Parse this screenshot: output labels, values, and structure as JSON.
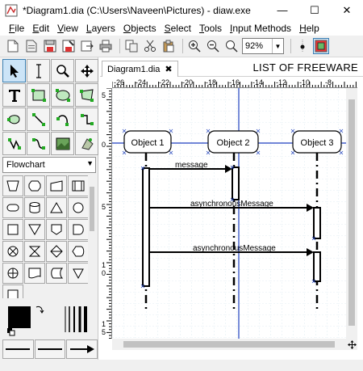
{
  "window": {
    "title": "*Diagram1.dia (C:\\Users\\Naveen\\Pictures) - diaw.exe",
    "minimize": "—",
    "maximize": "☐",
    "close": "✕"
  },
  "menu": [
    {
      "label": "File",
      "u": "F",
      "rest": "ile"
    },
    {
      "label": "Edit",
      "u": "E",
      "rest": "dit"
    },
    {
      "label": "View",
      "u": "V",
      "rest": "iew"
    },
    {
      "label": "Layers",
      "u": "L",
      "rest": "ayers"
    },
    {
      "label": "Objects",
      "u": "O",
      "rest": "bjects"
    },
    {
      "label": "Select",
      "u": "S",
      "rest": "elect"
    },
    {
      "label": "Tools",
      "u": "T",
      "rest": "ools"
    },
    {
      "label": "Input Methods",
      "u": "I",
      "rest": "nput Methods"
    },
    {
      "label": "Help",
      "u": "H",
      "rest": "elp"
    }
  ],
  "toolbar": {
    "zoom": "92%"
  },
  "sheet": {
    "selected": "Flowchart"
  },
  "tab": {
    "label": "Diagram1.dia",
    "close": "✖"
  },
  "diagram": {
    "overlay_title": "LIST OF FREEWARE",
    "objects": [
      "Object 1",
      "Object 2",
      "Object 3"
    ],
    "messages": [
      "message",
      "asynchronousMessage",
      "asynchronousMessage"
    ]
  },
  "rulers": {
    "h_ticks": [
      "-26",
      "-24",
      "-22",
      "-20",
      "-18",
      "-16",
      "-14",
      "-12",
      "-10",
      "-8"
    ],
    "v_ticks": [
      "5",
      "0",
      "5",
      "1",
      "0",
      "1",
      "5"
    ]
  },
  "colors": {
    "accent": "#3c7fb1",
    "grid": "#c8dde8",
    "guide": "#1f3fbf"
  }
}
